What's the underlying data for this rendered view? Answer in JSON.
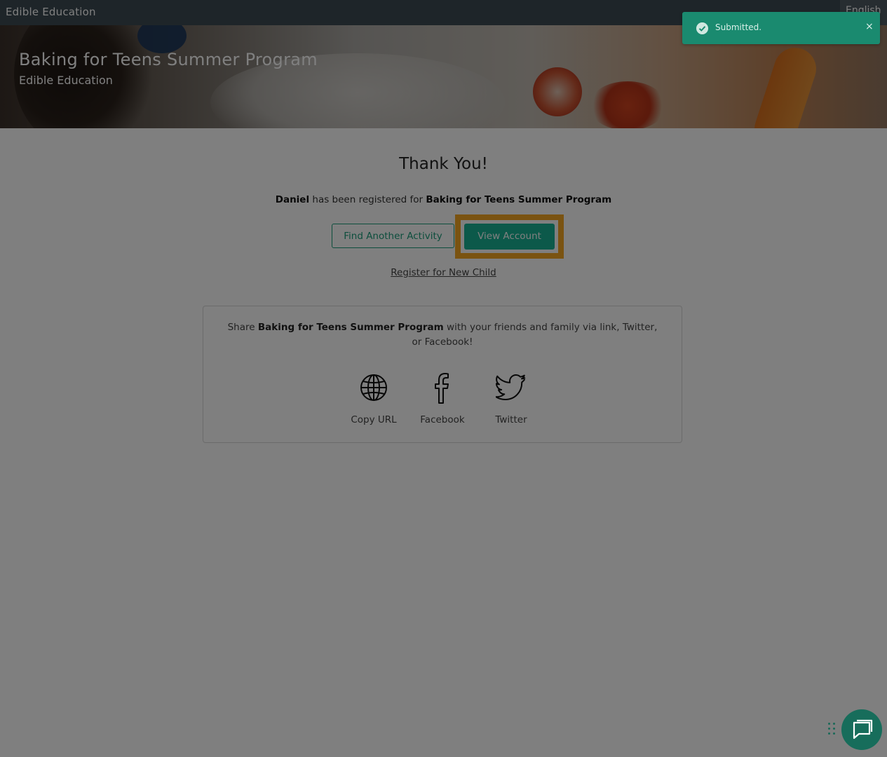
{
  "topbar": {
    "org_name": "Edible Education",
    "language": "English"
  },
  "hero": {
    "title": "Baking for Teens Summer Program",
    "subtitle": "Edible Education"
  },
  "confirmation": {
    "heading": "Thank You!",
    "child_name": "Daniel",
    "registered_text": " has been registered for ",
    "program_name": "Baking for Teens Summer Program",
    "find_button": "Find Another Activity",
    "view_button": "View Account",
    "register_link": "Register for New Child"
  },
  "share": {
    "prefix": "Share ",
    "program_name": "Baking for Teens Summer Program",
    "suffix": " with your friends and family via link, Twitter, or Facebook!",
    "items": [
      {
        "label": "Copy URL",
        "icon": "globe-icon"
      },
      {
        "label": "Facebook",
        "icon": "facebook-icon"
      },
      {
        "label": "Twitter",
        "icon": "twitter-icon"
      }
    ]
  },
  "toast": {
    "message": "Submitted.",
    "close": "×"
  },
  "colors": {
    "accent": "#19b394",
    "highlight": "#f5a623",
    "topbar": "#3c4a52",
    "toast": "#1a8a6f"
  }
}
